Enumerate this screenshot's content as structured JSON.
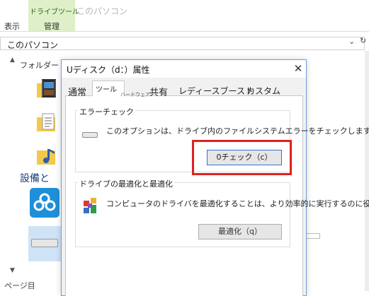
{
  "ribbon": {
    "tool_tab": "ドライブツール",
    "window_title": "このパソコン",
    "tab_view": "表示",
    "tab_manage": "管理"
  },
  "address": {
    "path": "このパソコン"
  },
  "left_pane": {
    "folder_heading": "フォルダー",
    "device_heading": "設備と",
    "status": "ページ目"
  },
  "dialog": {
    "title": "Uディスク（d：）属性",
    "close": "✕",
    "tabs": {
      "general": "通常",
      "tools": "ツール",
      "hardware": "ハードウェア",
      "sharing": "共有",
      "readyboost": "レディースブースト",
      "customize": "カスタム"
    },
    "error_check": {
      "title": "エラーチェック",
      "description": "このオプションは、ドライブ内のファイルシステムエラーをチェックします",
      "button": "0チェック（c）"
    },
    "optimize": {
      "title": "ドライブの最適化と最適化",
      "description": "コンピュータのドライバを最適化することは、より効率的に実行するのに役",
      "button": "最適化（q）"
    }
  },
  "colors": {
    "highlight": "#e02020",
    "accent": "#3375c9",
    "ribbon_green": "#dff0c8"
  },
  "icons": [
    "video-folder-icon",
    "document-folder-icon",
    "music-folder-icon",
    "cloud-icon",
    "drive-icon",
    "defrag-icon",
    "close-icon",
    "chevron-down-icon"
  ]
}
